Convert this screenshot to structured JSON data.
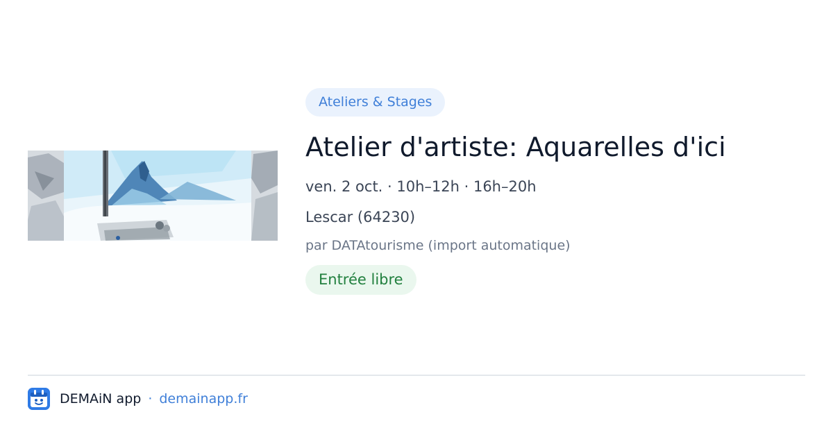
{
  "event": {
    "category": "Ateliers & Stages",
    "title": "Atelier d'artiste: Aquarelles d'ici",
    "datetime": "ven. 2 oct. · 10h–12h · 16h–20h",
    "location": "Lescar (64230)",
    "source": "par DATAtourisme (import automatique)",
    "price": "Entrée libre",
    "image_subject": "watercolor mountain landscape"
  },
  "footer": {
    "app_name": "DEMAiN app",
    "separator": "·",
    "url": "demainapp.fr",
    "logo_icon": "calendar-face-icon"
  },
  "colors": {
    "category_bg": "#eaf2fd",
    "category_text": "#3f7fd8",
    "price_bg": "#eaf7ee",
    "price_text": "#22803f",
    "title_text": "#101a2c",
    "link": "#3f7fd8"
  }
}
